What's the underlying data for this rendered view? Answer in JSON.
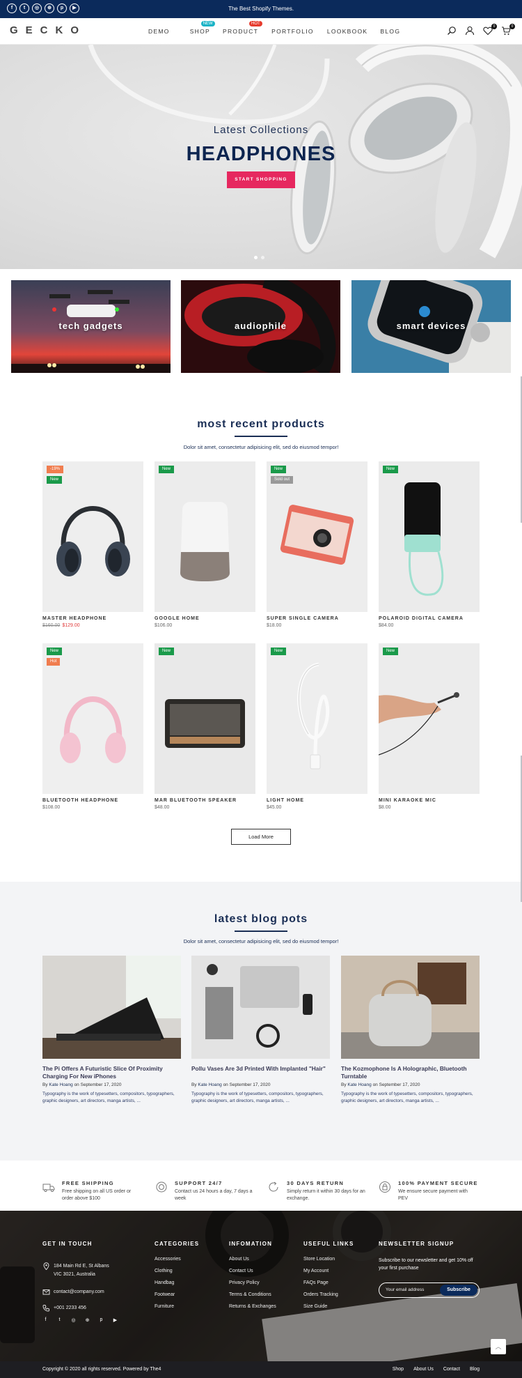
{
  "topbar": {
    "message": "The Best Shopify Themes.",
    "socials": [
      {
        "icon": "facebook-icon",
        "glyph": "f"
      },
      {
        "icon": "twitter-icon",
        "glyph": "t"
      },
      {
        "icon": "instagram-icon",
        "glyph": "◎"
      },
      {
        "icon": "dribbble-icon",
        "glyph": "⊕"
      },
      {
        "icon": "pinterest-icon",
        "glyph": "p"
      },
      {
        "icon": "youtube-icon",
        "glyph": "▶"
      }
    ]
  },
  "header": {
    "logo": "GECKO",
    "nav": [
      {
        "label": "DEMO"
      },
      {
        "label": "SHOP",
        "badge": "NEW"
      },
      {
        "label": "PRODUCT",
        "badge": "HOT"
      },
      {
        "label": "PORTFOLIO"
      },
      {
        "label": "LOOKBOOK"
      },
      {
        "label": "BLOG"
      }
    ],
    "wishlist_count": "0",
    "cart_count": "0"
  },
  "hero": {
    "subtitle": "Latest Collections",
    "title": "HEADPHONES",
    "button": "START SHOPPING",
    "slides": 2,
    "active_slide": 1
  },
  "categories": [
    {
      "label": "tech gadgets"
    },
    {
      "label": "audiophile"
    },
    {
      "label": "smart devices"
    }
  ],
  "products_section": {
    "title": "most recent products",
    "subtitle": "Dolor sit amet, consectetur adipisicing elit, sed do eiusmod tempor!",
    "load_more": "Load More",
    "products": [
      {
        "name": "MASTER HEADPHONE",
        "old_price": "$160.00",
        "price": "$129.00",
        "badges": [
          "-19%",
          "New"
        ]
      },
      {
        "name": "GOOGLE HOME",
        "price": "$106.00",
        "badges": [
          "New"
        ]
      },
      {
        "name": "SUPER SINGLE CAMERA",
        "price": "$18.00",
        "badges": [
          "New",
          "Sold out"
        ]
      },
      {
        "name": "POLAROID DIGITAL CAMERA",
        "price": "$84.00",
        "badges": [
          "New"
        ]
      },
      {
        "name": "BLUETOOTH HEADPHONE",
        "price": "$108.00",
        "badges": [
          "New",
          "Hot"
        ]
      },
      {
        "name": "MAR BLUETOOTH SPEAKER",
        "price": "$48.00",
        "badges": [
          "New"
        ]
      },
      {
        "name": "LIGHT HOME",
        "price": "$45.00",
        "badges": [
          "New"
        ]
      },
      {
        "name": "MINI KARAOKE MIC",
        "price": "$8.00",
        "badges": [
          "New"
        ]
      }
    ]
  },
  "blog_section": {
    "title": "latest blog pots",
    "subtitle": "Dolor sit amet, consectetur adipisicing elit, sed do eiusmod tempor!",
    "posts": [
      {
        "title": "The Pi Offers A Futuristic Slice Of Proximity Charging For New iPhones",
        "author": "Kate Hoang",
        "date": "September 17, 2020",
        "excerpt": "Typography is the work of typesetters, compositors, typographers, graphic designers, art directors, manga artists, ..."
      },
      {
        "title": "Pollu Vases Are 3d Printed With Implanted \"Hair\"",
        "author": "Kate Hoang",
        "date": "September 17, 2020",
        "excerpt": "Typography is the work of typesetters, compositors, typographers, graphic designers, art directors, manga artists, ..."
      },
      {
        "title": "The Kozmophone Is A Holographic, Bluetooth Turntable",
        "author": "Kate Hoang",
        "date": "September 17, 2020",
        "excerpt": "Typography is the work of typesetters, compositors, typographers, graphic designers, art directors, manga artists, ..."
      }
    ],
    "by": "By",
    "on": "on"
  },
  "features": [
    {
      "icon": "truck-icon",
      "title": "FREE SHIPPING",
      "text": "Free shipping on all US order or order above $100"
    },
    {
      "icon": "support-icon",
      "title": "SUPPORT 24/7",
      "text": "Contact us 24 hours a day, 7 days a week"
    },
    {
      "icon": "return-icon",
      "title": "30 DAYS RETURN",
      "text": "Simply return it within 30 days for an exchange."
    },
    {
      "icon": "secure-payment-icon",
      "title": "100% PAYMENT SECURE",
      "text": "We ensure secure payment with PEV"
    }
  ],
  "footer": {
    "get_in_touch": {
      "title": "GET IN TOUCH",
      "address1": "184 Main Rd E, St Albans",
      "address2": "VIC 3021, Australia",
      "email": "contact@company.com",
      "phone": "+001 2233 456"
    },
    "categories": {
      "title": "CATEGORIES",
      "links": [
        "Accessories",
        "Clothing",
        "Handbag",
        "Footwear",
        "Furniture"
      ]
    },
    "information": {
      "title": "INFOMATION",
      "links": [
        "About Us",
        "Contact Us",
        "Privacy Policy",
        "Terms & Conditions",
        "Returns & Exchanges"
      ]
    },
    "useful_links": {
      "title": "USEFUL LINKS",
      "links": [
        "Store Location",
        "My Account",
        "FAQs Page",
        "Orders Tracking",
        "Size Guide"
      ]
    },
    "newsletter": {
      "title": "NEWSLETTER SIGNUP",
      "text": "Subscribe to our newsletter and get 10% off your first purchase",
      "placeholder": "Your email address",
      "button": "Subscribe"
    },
    "copyright": "Copyright © 2020 all rights reserved. Powered by The4",
    "bottom_links": [
      "Shop",
      "About Us",
      "Contact",
      "Blog"
    ]
  },
  "colors": {
    "navy": "#0b2a5b",
    "pink": "#e6285f",
    "green": "#1a9a4a",
    "orange": "#f07d4f"
  }
}
